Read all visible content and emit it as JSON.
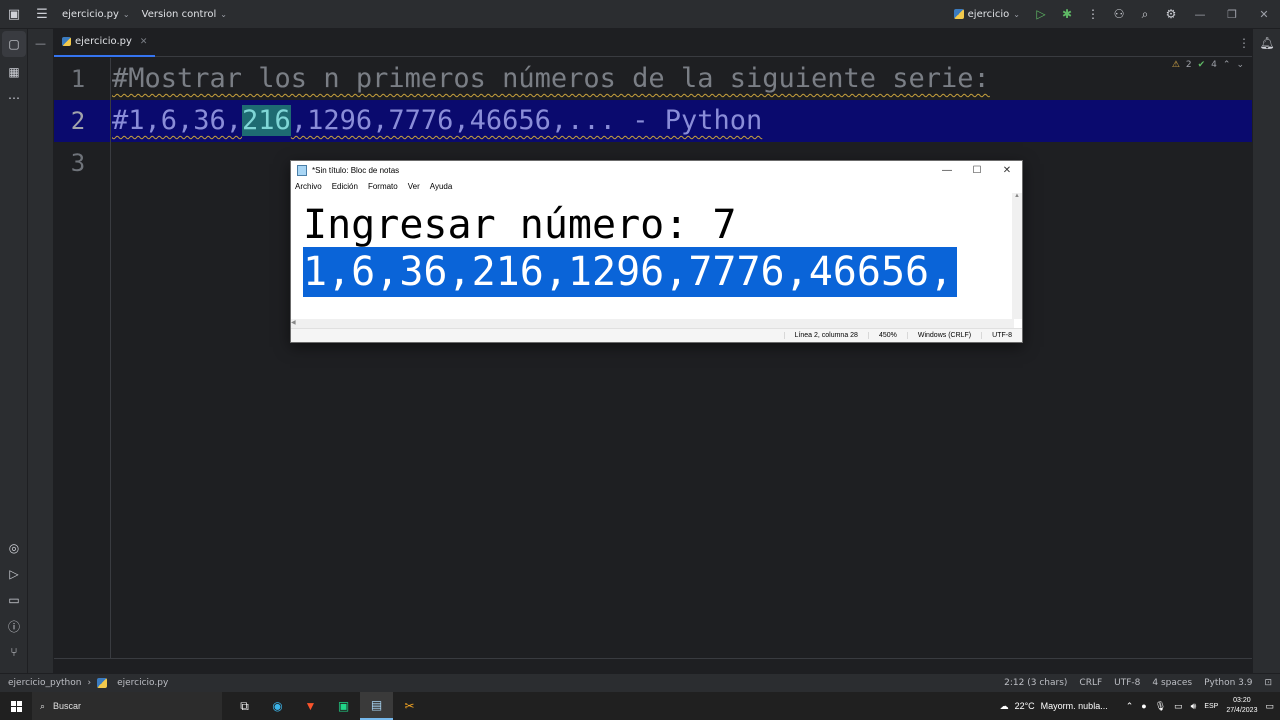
{
  "titlebar": {
    "project": "ejercicio.py",
    "version_control": "Version control",
    "run_config": "ejercicio"
  },
  "tabs": [
    {
      "label": "ejercicio.py"
    }
  ],
  "editor": {
    "line_numbers": [
      "1",
      "2",
      "3"
    ],
    "line1": "#Mostrar los n primeros números de la siguiente serie:",
    "line2_prefix": "#1,6,36,",
    "line2_selected": "216",
    "line2_suffix": ",1296,7776,46656,... - Python",
    "inspections": {
      "warnings": "2",
      "ok": "4"
    }
  },
  "notepad": {
    "title": "*Sin título: Bloc de notas",
    "menu": [
      "Archivo",
      "Edición",
      "Formato",
      "Ver",
      "Ayuda"
    ],
    "line1": "Ingresar número: 7",
    "line2": "1,6,36,216,1296,7776,46656,",
    "status": {
      "position": "Línea 2, columna 28",
      "zoom": "450%",
      "eol": "Windows (CRLF)",
      "encoding": "UTF-8"
    }
  },
  "statusbar": {
    "breadcrumb": [
      "ejercicio_python",
      "ejercicio.py"
    ],
    "caret": "2:12 (3 chars)",
    "line_sep": "CRLF",
    "encoding": "UTF-8",
    "indent": "4 spaces",
    "interpreter": "Python 3.9"
  },
  "taskbar": {
    "search": "Buscar",
    "weather_temp": "22°C",
    "weather_text": "Mayorm. nubla...",
    "lang": "ESP",
    "time": "03:20",
    "date": "27/4/2023"
  },
  "colors": {
    "ide_bg": "#1e1f22",
    "line_highlight": "#0a0a6e",
    "notepad_selection": "#0a64d8",
    "accent": "#3574f0"
  }
}
